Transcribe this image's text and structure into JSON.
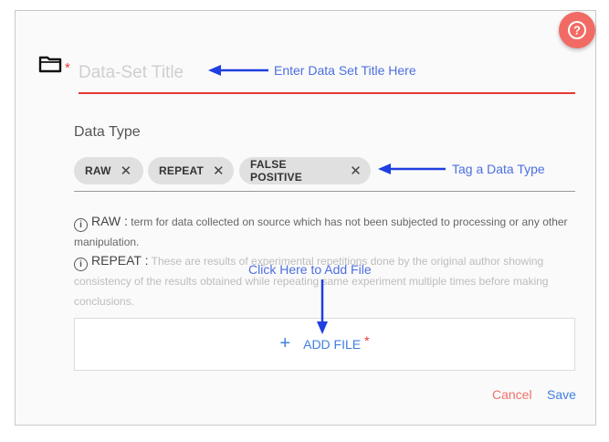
{
  "form": {
    "title_placeholder": "Data-Set Title",
    "required_mark": "*",
    "section_label": "Data Type",
    "chips": [
      {
        "label": "RAW",
        "remove": "✕"
      },
      {
        "label": "REPEAT",
        "remove": "✕"
      },
      {
        "label": "FALSE POSITIVE",
        "remove": "✕"
      }
    ],
    "info": [
      {
        "term": "RAW :",
        "text": "term for data collected on source which has not been subjected to processing or any other manipulation."
      },
      {
        "term": "REPEAT :",
        "text": "These are results of experimental repetitions done by the original author showing consistency of the results obtained while repeating same experiment multiple times before making conclusions."
      }
    ],
    "add_file_label": "ADD FILE",
    "add_file_icon": "+",
    "cancel_label": "Cancel",
    "save_label": "Save"
  },
  "annotations": {
    "title_hint": "Enter Data Set Title Here",
    "type_hint": "Tag a Data Type",
    "file_hint": "Click Here to Add File"
  },
  "colors": {
    "accent": "#3f7fe0",
    "required": "#e53935",
    "help_button": "#f26a64",
    "annotation": "#4c6fe0"
  },
  "icons": {
    "help": "help-circle-icon",
    "folder": "folder-icon",
    "info": "info-icon",
    "remove": "close-icon",
    "add": "plus-icon"
  }
}
